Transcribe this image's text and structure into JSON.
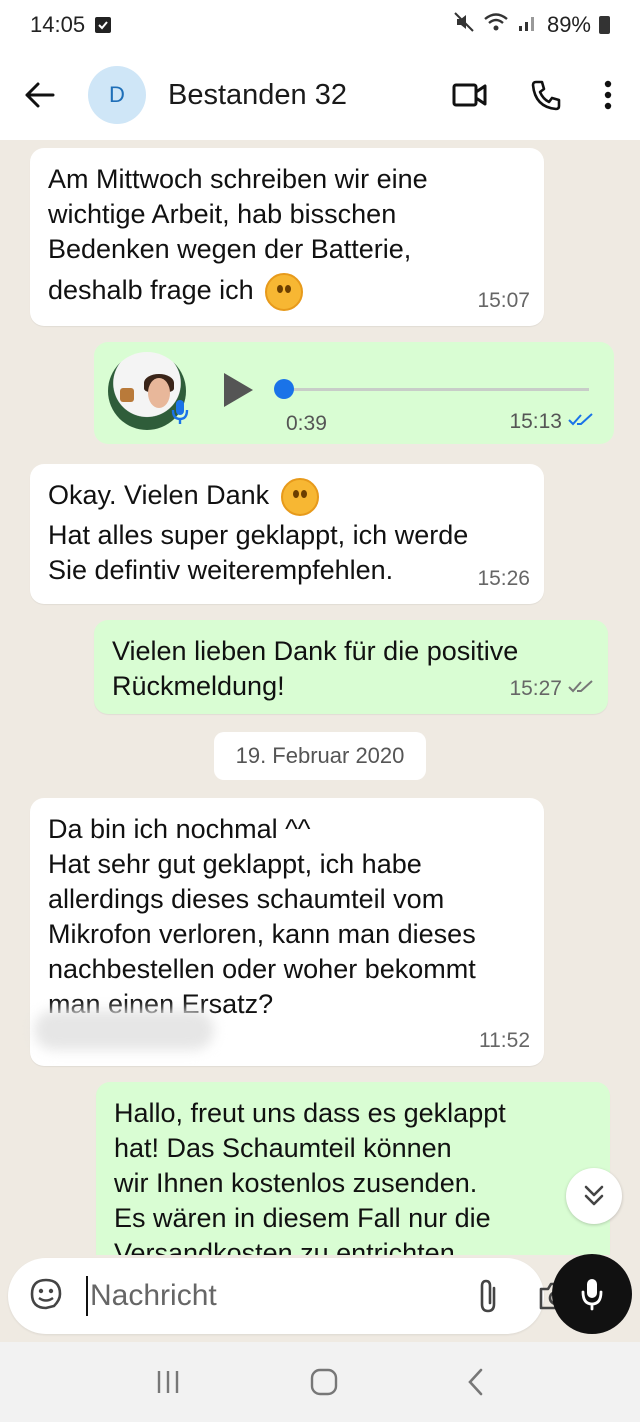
{
  "status_bar": {
    "time": "14:05",
    "battery": "89%"
  },
  "header": {
    "avatar_letter": "D",
    "contact_name": "Bestanden 32"
  },
  "messages": [
    {
      "lines": [
        "Am Mittwoch schreiben wir eine",
        "wichtige Arbeit, hab bisschen",
        "Bedenken wegen der Batterie,",
        "deshalb frage ich"
      ],
      "time": "15:07"
    },
    {
      "type": "voice",
      "duration": "0:39",
      "time": "15:13"
    },
    {
      "lines": [
        "Okay. Vielen Dank",
        "Hat alles super geklappt, ich werde",
        "Sie defintiv weiterempfehlen."
      ],
      "time": "15:26"
    },
    {
      "lines": [
        "Vielen lieben Dank für die positive",
        "Rückmeldung!"
      ],
      "time": "15:27"
    },
    {
      "lines": [
        "Da bin ich nochmal ^^",
        "Hat sehr gut geklappt, ich habe",
        "allerdings dieses schaumteil vom",
        "Mikrofon verloren, kann man dieses",
        "nachbestellen oder woher bekommt",
        "man einen Ersatz?"
      ],
      "time": "11:52"
    },
    {
      "lines": [
        "Hallo, freut uns dass es geklappt",
        "hat! Das Schaumteil können",
        "wir Ihnen kostenlos zusenden.",
        "Es wären in diesem Fall nur die",
        "Versandkosten zu entrichten"
      ]
    }
  ],
  "date_separator": "19. Februar 2020",
  "input": {
    "placeholder": "Nachricht"
  },
  "colors": {
    "incoming": "#ffffff",
    "outgoing": "#d9fdd3",
    "background": "#efeae2",
    "read_tick": "#1a73e8"
  }
}
